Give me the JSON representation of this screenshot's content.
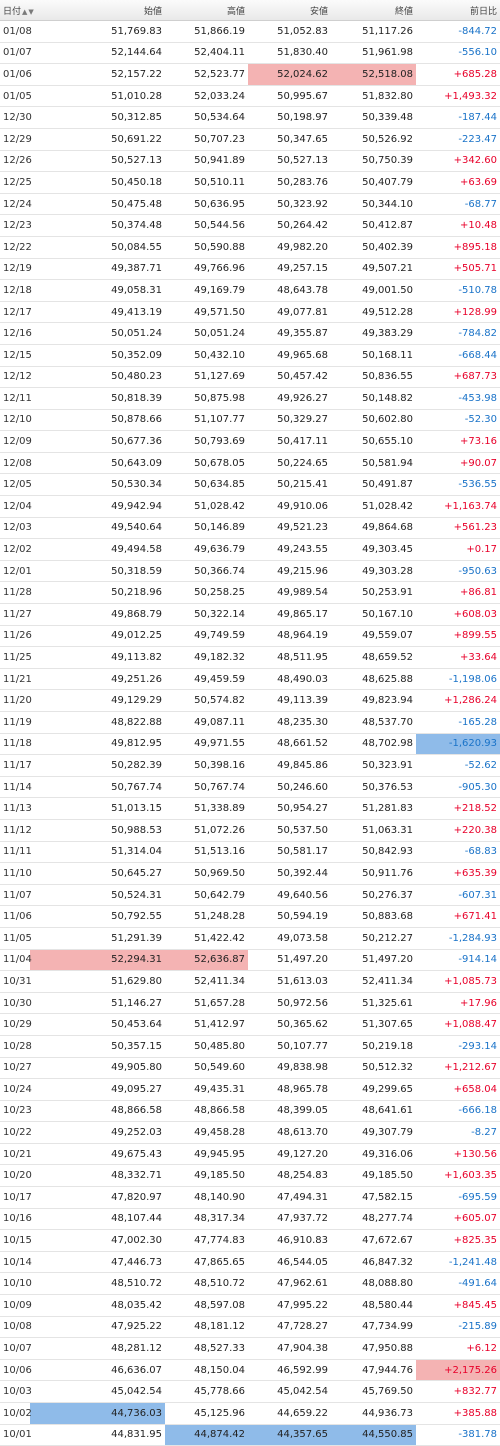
{
  "columns": {
    "date": "日付",
    "open": "始値",
    "high": "高値",
    "low": "安値",
    "close": "終値",
    "change": "前日比"
  },
  "sort_up_icon": "▲",
  "sort_down_icon": "▼",
  "colors": {
    "up": "#e8002a",
    "down": "#1a73c8",
    "highlight_high": "#f4b3b3",
    "highlight_low": "#8fbbe9"
  },
  "rows": [
    {
      "date": "01/08",
      "open": "51,769.83",
      "high": "51,866.19",
      "low": "51,052.83",
      "close": "51,117.26",
      "change": "-844.72",
      "dir": "down",
      "hl": {}
    },
    {
      "date": "01/07",
      "open": "52,144.64",
      "high": "52,404.11",
      "low": "51,830.40",
      "close": "51,961.98",
      "change": "-556.10",
      "dir": "down",
      "hl": {}
    },
    {
      "date": "01/06",
      "open": "52,157.22",
      "high": "52,523.77",
      "low": "52,024.62",
      "close": "52,518.08",
      "change": "+685.28",
      "dir": "up",
      "hl": {
        "low": "red",
        "close": "red"
      }
    },
    {
      "date": "01/05",
      "open": "51,010.28",
      "high": "52,033.24",
      "low": "50,995.67",
      "close": "51,832.80",
      "change": "+1,493.32",
      "dir": "up",
      "hl": {}
    },
    {
      "date": "12/30",
      "open": "50,312.85",
      "high": "50,534.64",
      "low": "50,198.97",
      "close": "50,339.48",
      "change": "-187.44",
      "dir": "down",
      "hl": {}
    },
    {
      "date": "12/29",
      "open": "50,691.22",
      "high": "50,707.23",
      "low": "50,347.65",
      "close": "50,526.92",
      "change": "-223.47",
      "dir": "down",
      "hl": {}
    },
    {
      "date": "12/26",
      "open": "50,527.13",
      "high": "50,941.89",
      "low": "50,527.13",
      "close": "50,750.39",
      "change": "+342.60",
      "dir": "up",
      "hl": {}
    },
    {
      "date": "12/25",
      "open": "50,450.18",
      "high": "50,510.11",
      "low": "50,283.76",
      "close": "50,407.79",
      "change": "+63.69",
      "dir": "up",
      "hl": {}
    },
    {
      "date": "12/24",
      "open": "50,475.48",
      "high": "50,636.95",
      "low": "50,323.92",
      "close": "50,344.10",
      "change": "-68.77",
      "dir": "down",
      "hl": {}
    },
    {
      "date": "12/23",
      "open": "50,374.48",
      "high": "50,544.56",
      "low": "50,264.42",
      "close": "50,412.87",
      "change": "+10.48",
      "dir": "up",
      "hl": {}
    },
    {
      "date": "12/22",
      "open": "50,084.55",
      "high": "50,590.88",
      "low": "49,982.20",
      "close": "50,402.39",
      "change": "+895.18",
      "dir": "up",
      "hl": {}
    },
    {
      "date": "12/19",
      "open": "49,387.71",
      "high": "49,766.96",
      "low": "49,257.15",
      "close": "49,507.21",
      "change": "+505.71",
      "dir": "up",
      "hl": {}
    },
    {
      "date": "12/18",
      "open": "49,058.31",
      "high": "49,169.79",
      "low": "48,643.78",
      "close": "49,001.50",
      "change": "-510.78",
      "dir": "down",
      "hl": {}
    },
    {
      "date": "12/17",
      "open": "49,413.19",
      "high": "49,571.50",
      "low": "49,077.81",
      "close": "49,512.28",
      "change": "+128.99",
      "dir": "up",
      "hl": {}
    },
    {
      "date": "12/16",
      "open": "50,051.24",
      "high": "50,051.24",
      "low": "49,355.87",
      "close": "49,383.29",
      "change": "-784.82",
      "dir": "down",
      "hl": {}
    },
    {
      "date": "12/15",
      "open": "50,352.09",
      "high": "50,432.10",
      "low": "49,965.68",
      "close": "50,168.11",
      "change": "-668.44",
      "dir": "down",
      "hl": {}
    },
    {
      "date": "12/12",
      "open": "50,480.23",
      "high": "51,127.69",
      "low": "50,457.42",
      "close": "50,836.55",
      "change": "+687.73",
      "dir": "up",
      "hl": {}
    },
    {
      "date": "12/11",
      "open": "50,818.39",
      "high": "50,875.98",
      "low": "49,926.27",
      "close": "50,148.82",
      "change": "-453.98",
      "dir": "down",
      "hl": {}
    },
    {
      "date": "12/10",
      "open": "50,878.66",
      "high": "51,107.77",
      "low": "50,329.27",
      "close": "50,602.80",
      "change": "-52.30",
      "dir": "down",
      "hl": {}
    },
    {
      "date": "12/09",
      "open": "50,677.36",
      "high": "50,793.69",
      "low": "50,417.11",
      "close": "50,655.10",
      "change": "+73.16",
      "dir": "up",
      "hl": {}
    },
    {
      "date": "12/08",
      "open": "50,643.09",
      "high": "50,678.05",
      "low": "50,224.65",
      "close": "50,581.94",
      "change": "+90.07",
      "dir": "up",
      "hl": {}
    },
    {
      "date": "12/05",
      "open": "50,530.34",
      "high": "50,634.85",
      "low": "50,215.41",
      "close": "50,491.87",
      "change": "-536.55",
      "dir": "down",
      "hl": {}
    },
    {
      "date": "12/04",
      "open": "49,942.94",
      "high": "51,028.42",
      "low": "49,910.06",
      "close": "51,028.42",
      "change": "+1,163.74",
      "dir": "up",
      "hl": {}
    },
    {
      "date": "12/03",
      "open": "49,540.64",
      "high": "50,146.89",
      "low": "49,521.23",
      "close": "49,864.68",
      "change": "+561.23",
      "dir": "up",
      "hl": {}
    },
    {
      "date": "12/02",
      "open": "49,494.58",
      "high": "49,636.79",
      "low": "49,243.55",
      "close": "49,303.45",
      "change": "+0.17",
      "dir": "up",
      "hl": {}
    },
    {
      "date": "12/01",
      "open": "50,318.59",
      "high": "50,366.74",
      "low": "49,215.96",
      "close": "49,303.28",
      "change": "-950.63",
      "dir": "down",
      "hl": {}
    },
    {
      "date": "11/28",
      "open": "50,218.96",
      "high": "50,258.25",
      "low": "49,989.54",
      "close": "50,253.91",
      "change": "+86.81",
      "dir": "up",
      "hl": {}
    },
    {
      "date": "11/27",
      "open": "49,868.79",
      "high": "50,322.14",
      "low": "49,865.17",
      "close": "50,167.10",
      "change": "+608.03",
      "dir": "up",
      "hl": {}
    },
    {
      "date": "11/26",
      "open": "49,012.25",
      "high": "49,749.59",
      "low": "48,964.19",
      "close": "49,559.07",
      "change": "+899.55",
      "dir": "up",
      "hl": {}
    },
    {
      "date": "11/25",
      "open": "49,113.82",
      "high": "49,182.32",
      "low": "48,511.95",
      "close": "48,659.52",
      "change": "+33.64",
      "dir": "up",
      "hl": {}
    },
    {
      "date": "11/21",
      "open": "49,251.26",
      "high": "49,459.59",
      "low": "48,490.03",
      "close": "48,625.88",
      "change": "-1,198.06",
      "dir": "down",
      "hl": {}
    },
    {
      "date": "11/20",
      "open": "49,129.29",
      "high": "50,574.82",
      "low": "49,113.39",
      "close": "49,823.94",
      "change": "+1,286.24",
      "dir": "up",
      "hl": {}
    },
    {
      "date": "11/19",
      "open": "48,822.88",
      "high": "49,087.11",
      "low": "48,235.30",
      "close": "48,537.70",
      "change": "-165.28",
      "dir": "down",
      "hl": {}
    },
    {
      "date": "11/18",
      "open": "49,812.95",
      "high": "49,971.55",
      "low": "48,661.52",
      "close": "48,702.98",
      "change": "-1,620.93",
      "dir": "down",
      "hl": {
        "change": "blue"
      }
    },
    {
      "date": "11/17",
      "open": "50,282.39",
      "high": "50,398.16",
      "low": "49,845.86",
      "close": "50,323.91",
      "change": "-52.62",
      "dir": "down",
      "hl": {}
    },
    {
      "date": "11/14",
      "open": "50,767.74",
      "high": "50,767.74",
      "low": "50,246.60",
      "close": "50,376.53",
      "change": "-905.30",
      "dir": "down",
      "hl": {}
    },
    {
      "date": "11/13",
      "open": "51,013.15",
      "high": "51,338.89",
      "low": "50,954.27",
      "close": "51,281.83",
      "change": "+218.52",
      "dir": "up",
      "hl": {}
    },
    {
      "date": "11/12",
      "open": "50,988.53",
      "high": "51,072.26",
      "low": "50,537.50",
      "close": "51,063.31",
      "change": "+220.38",
      "dir": "up",
      "hl": {}
    },
    {
      "date": "11/11",
      "open": "51,314.04",
      "high": "51,513.16",
      "low": "50,581.17",
      "close": "50,842.93",
      "change": "-68.83",
      "dir": "down",
      "hl": {}
    },
    {
      "date": "11/10",
      "open": "50,645.27",
      "high": "50,969.50",
      "low": "50,392.44",
      "close": "50,911.76",
      "change": "+635.39",
      "dir": "up",
      "hl": {}
    },
    {
      "date": "11/07",
      "open": "50,524.31",
      "high": "50,642.79",
      "low": "49,640.56",
      "close": "50,276.37",
      "change": "-607.31",
      "dir": "down",
      "hl": {}
    },
    {
      "date": "11/06",
      "open": "50,792.55",
      "high": "51,248.28",
      "low": "50,594.19",
      "close": "50,883.68",
      "change": "+671.41",
      "dir": "up",
      "hl": {}
    },
    {
      "date": "11/05",
      "open": "51,291.39",
      "high": "51,422.42",
      "low": "49,073.58",
      "close": "50,212.27",
      "change": "-1,284.93",
      "dir": "down",
      "hl": {}
    },
    {
      "date": "11/04",
      "open": "52,294.31",
      "high": "52,636.87",
      "low": "51,497.20",
      "close": "51,497.20",
      "change": "-914.14",
      "dir": "down",
      "hl": {
        "open": "red",
        "high": "red"
      }
    },
    {
      "date": "10/31",
      "open": "51,629.80",
      "high": "52,411.34",
      "low": "51,613.03",
      "close": "52,411.34",
      "change": "+1,085.73",
      "dir": "up",
      "hl": {}
    },
    {
      "date": "10/30",
      "open": "51,146.27",
      "high": "51,657.28",
      "low": "50,972.56",
      "close": "51,325.61",
      "change": "+17.96",
      "dir": "up",
      "hl": {}
    },
    {
      "date": "10/29",
      "open": "50,453.64",
      "high": "51,412.97",
      "low": "50,365.62",
      "close": "51,307.65",
      "change": "+1,088.47",
      "dir": "up",
      "hl": {}
    },
    {
      "date": "10/28",
      "open": "50,357.15",
      "high": "50,485.80",
      "low": "50,107.77",
      "close": "50,219.18",
      "change": "-293.14",
      "dir": "down",
      "hl": {}
    },
    {
      "date": "10/27",
      "open": "49,905.80",
      "high": "50,549.60",
      "low": "49,838.98",
      "close": "50,512.32",
      "change": "+1,212.67",
      "dir": "up",
      "hl": {}
    },
    {
      "date": "10/24",
      "open": "49,095.27",
      "high": "49,435.31",
      "low": "48,965.78",
      "close": "49,299.65",
      "change": "+658.04",
      "dir": "up",
      "hl": {}
    },
    {
      "date": "10/23",
      "open": "48,866.58",
      "high": "48,866.58",
      "low": "48,399.05",
      "close": "48,641.61",
      "change": "-666.18",
      "dir": "down",
      "hl": {}
    },
    {
      "date": "10/22",
      "open": "49,252.03",
      "high": "49,458.28",
      "low": "48,613.70",
      "close": "49,307.79",
      "change": "-8.27",
      "dir": "down",
      "hl": {}
    },
    {
      "date": "10/21",
      "open": "49,675.43",
      "high": "49,945.95",
      "low": "49,127.20",
      "close": "49,316.06",
      "change": "+130.56",
      "dir": "up",
      "hl": {}
    },
    {
      "date": "10/20",
      "open": "48,332.71",
      "high": "49,185.50",
      "low": "48,254.83",
      "close": "49,185.50",
      "change": "+1,603.35",
      "dir": "up",
      "hl": {}
    },
    {
      "date": "10/17",
      "open": "47,820.97",
      "high": "48,140.90",
      "low": "47,494.31",
      "close": "47,582.15",
      "change": "-695.59",
      "dir": "down",
      "hl": {}
    },
    {
      "date": "10/16",
      "open": "48,107.44",
      "high": "48,317.34",
      "low": "47,937.72",
      "close": "48,277.74",
      "change": "+605.07",
      "dir": "up",
      "hl": {}
    },
    {
      "date": "10/15",
      "open": "47,002.30",
      "high": "47,774.83",
      "low": "46,910.83",
      "close": "47,672.67",
      "change": "+825.35",
      "dir": "up",
      "hl": {}
    },
    {
      "date": "10/14",
      "open": "47,446.73",
      "high": "47,865.65",
      "low": "46,544.05",
      "close": "46,847.32",
      "change": "-1,241.48",
      "dir": "down",
      "hl": {}
    },
    {
      "date": "10/10",
      "open": "48,510.72",
      "high": "48,510.72",
      "low": "47,962.61",
      "close": "48,088.80",
      "change": "-491.64",
      "dir": "down",
      "hl": {}
    },
    {
      "date": "10/09",
      "open": "48,035.42",
      "high": "48,597.08",
      "low": "47,995.22",
      "close": "48,580.44",
      "change": "+845.45",
      "dir": "up",
      "hl": {}
    },
    {
      "date": "10/08",
      "open": "47,925.22",
      "high": "48,181.12",
      "low": "47,728.27",
      "close": "47,734.99",
      "change": "-215.89",
      "dir": "down",
      "hl": {}
    },
    {
      "date": "10/07",
      "open": "48,281.12",
      "high": "48,527.33",
      "low": "47,904.38",
      "close": "47,950.88",
      "change": "+6.12",
      "dir": "up",
      "hl": {}
    },
    {
      "date": "10/06",
      "open": "46,636.07",
      "high": "48,150.04",
      "low": "46,592.99",
      "close": "47,944.76",
      "change": "+2,175.26",
      "dir": "up",
      "hl": {
        "change": "red"
      }
    },
    {
      "date": "10/03",
      "open": "45,042.54",
      "high": "45,778.66",
      "low": "45,042.54",
      "close": "45,769.50",
      "change": "+832.77",
      "dir": "up",
      "hl": {}
    },
    {
      "date": "10/02",
      "open": "44,736.03",
      "high": "45,125.96",
      "low": "44,659.22",
      "close": "44,936.73",
      "change": "+385.88",
      "dir": "up",
      "hl": {
        "open": "blue"
      }
    },
    {
      "date": "10/01",
      "open": "44,831.95",
      "high": "44,874.42",
      "low": "44,357.65",
      "close": "44,550.85",
      "change": "-381.78",
      "dir": "down",
      "hl": {
        "high": "blue",
        "low": "blue",
        "close": "blue"
      }
    }
  ]
}
